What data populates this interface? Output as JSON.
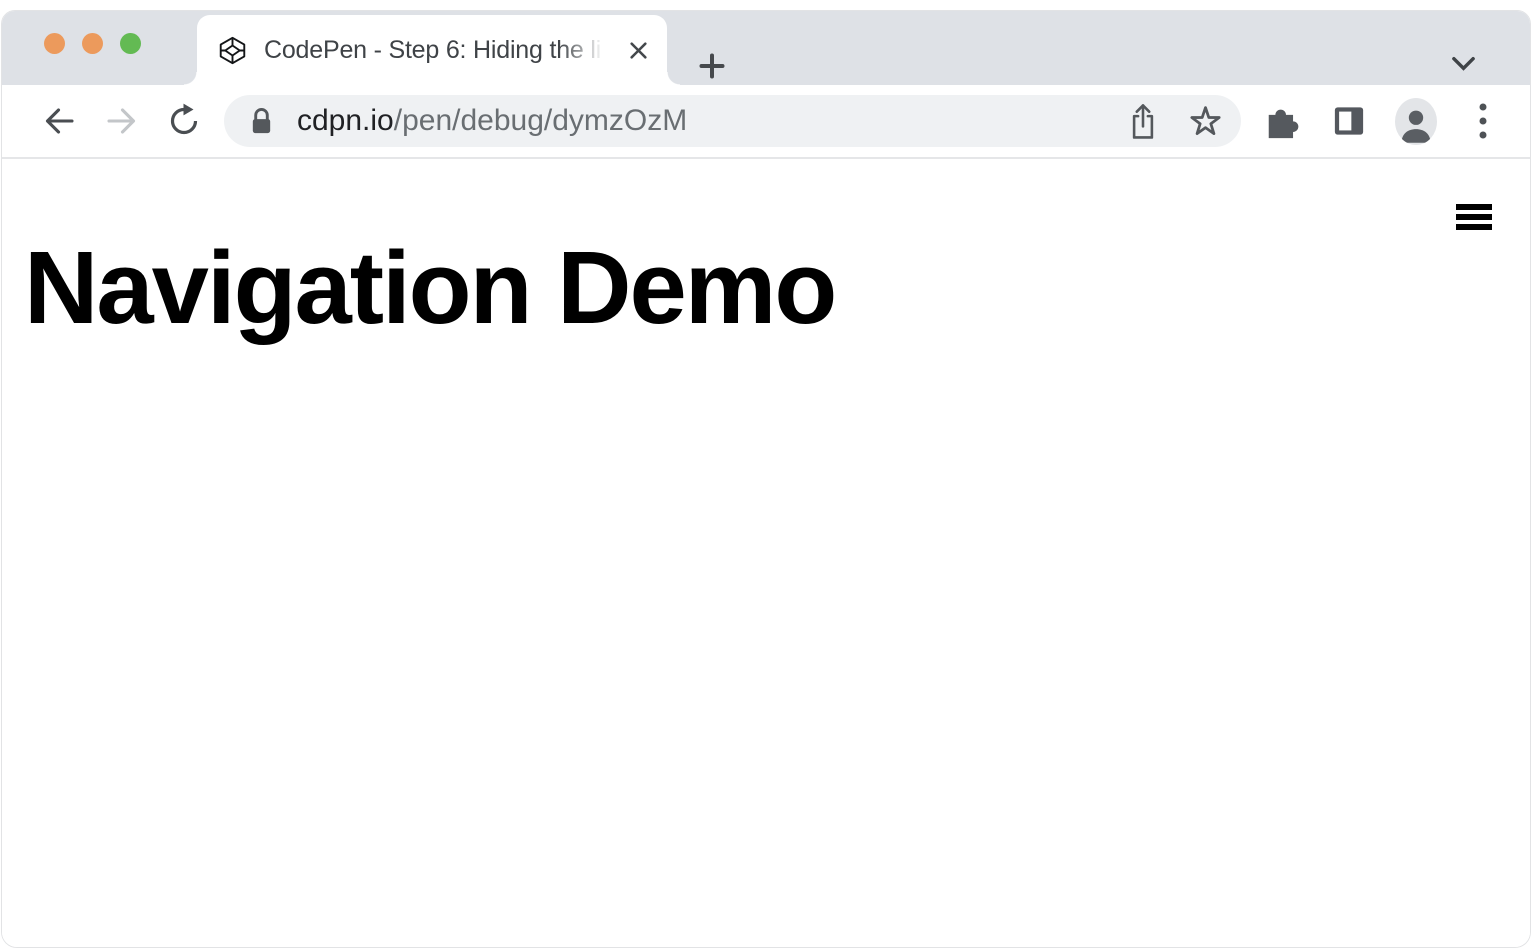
{
  "browser": {
    "window_controls": [
      {
        "name": "close-window-button",
        "color": "#EC9A5C"
      },
      {
        "name": "minimize-window-button",
        "color": "#EC9A5C"
      },
      {
        "name": "zoom-window-button",
        "color": "#63BA53"
      }
    ],
    "tab": {
      "favicon": "codepen-logo-icon",
      "title": "CodePen - Step 6: Hiding the li",
      "close_icon": "close-icon"
    },
    "new_tab_icon": "plus-icon",
    "tab_strip_icon": "chevron-down-icon",
    "toolbar": {
      "back_icon": "back-arrow-icon",
      "forward_icon": "forward-arrow-icon",
      "reload_icon": "reload-icon",
      "url": {
        "security_icon": "lock-icon",
        "domain": "cdpn.io",
        "path": "/pen/debug/dymzOzM"
      },
      "share_icon": "share-icon",
      "bookmark_icon": "star-icon",
      "extensions_icon": "puzzle-icon",
      "side_panel_icon": "side-panel-icon",
      "profile_icon": "person-icon",
      "menu_icon": "kebab-menu-icon"
    }
  },
  "page": {
    "heading": "Navigation Demo",
    "menu_icon": "hamburger-menu-icon"
  },
  "colors": {
    "titlebar_bg": "#DEE1E6",
    "toolbar_bg": "#FFFFFF",
    "urlbar_bg": "#EFF1F3",
    "icon_dark": "#4E5256",
    "icon_disabled": "#C3C6C9",
    "tab_title_text": "#3F4347",
    "url_domain_text": "#202124",
    "url_path_text": "#696E72",
    "heading_text": "#000000",
    "hamburger_color": "#000000"
  }
}
